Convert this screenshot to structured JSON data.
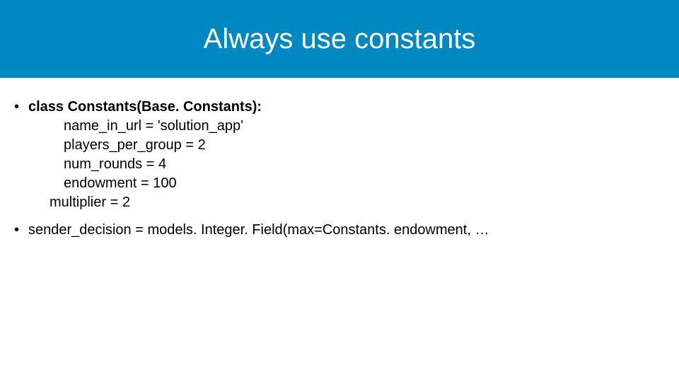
{
  "title": "Always use constants",
  "bullets": {
    "first": {
      "heading_bold": "class Constants(Base. Constants):",
      "lines": [
        "name_in_url = 'solution_app'",
        "players_per_group = 2",
        "num_rounds = 4",
        "endowment = 100"
      ],
      "last_line": "multiplier = 2"
    },
    "second": "sender_decision = models. Integer. Field(max=Constants. endowment, …"
  }
}
